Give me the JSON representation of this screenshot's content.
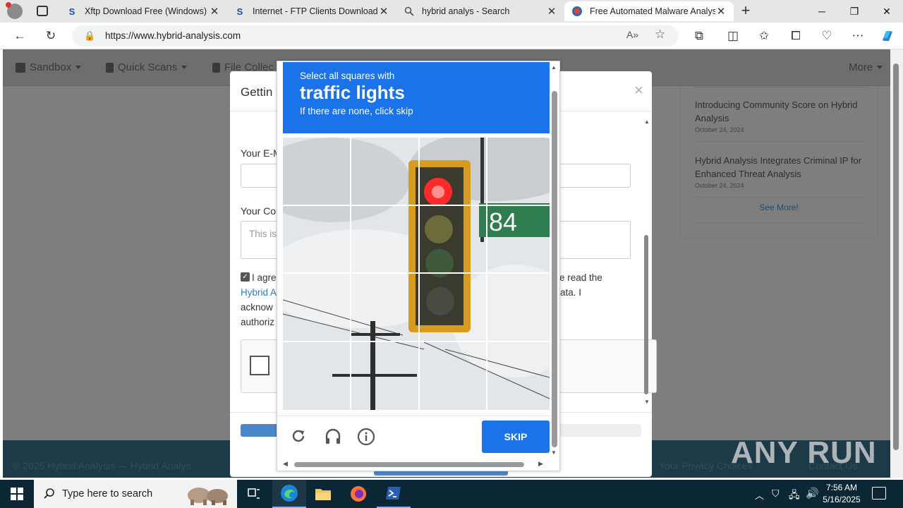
{
  "browser": {
    "tabs": [
      {
        "title": "Xftp Download Free (Windows) - ",
        "icon": "softpedia-s-icon"
      },
      {
        "title": "Internet - FTP Clients Downloads",
        "icon": "softpedia-s-icon"
      },
      {
        "title": "hybrid analys - Search",
        "icon": "search-icon"
      },
      {
        "title": "Free Automated Malware Analysi",
        "icon": "hybrid-analysis-icon"
      }
    ],
    "url": "https://www.hybrid-analysis.com"
  },
  "site": {
    "nav": {
      "sandbox": "Sandbox",
      "quick_scans": "Quick Scans",
      "file_collections": "File Collec",
      "more": "More"
    },
    "news": [
      {
        "title": "Introducing Community Score on Hybrid Analysis",
        "date": "October 24, 2024"
      },
      {
        "title": "Hybrid Analysis Integrates Criminal IP for Enhanced Threat Analysis",
        "date": "October 24, 2024"
      }
    ],
    "see_more": "See More!",
    "footer": {
      "copyright": "© 2025 Hybrid Analysis — Hybrid Analys",
      "right": "Your Privacy Choices",
      "contact": "Contact Us"
    }
  },
  "modal": {
    "title": "Gettin",
    "email_label": "Your E-M",
    "comment_label": "Your Co",
    "comment_placeholder": "This is",
    "agree_line1": "I agre",
    "agree_line1_right": "e read the",
    "agree_line2_link": "Hybrid A",
    "agree_line2_right": "ata. I",
    "agree_line3": "acknow",
    "agree_line4": "authoriz"
  },
  "captcha": {
    "instruction": "Select all squares with",
    "target": "traffic lights",
    "hint": "If there are none, click skip",
    "sign_text": "84",
    "skip_label": "SKIP"
  },
  "watermark": "ANY RUN",
  "taskbar": {
    "search_placeholder": "Type here to search",
    "time": "7:56 AM",
    "date": "5/16/2025"
  }
}
